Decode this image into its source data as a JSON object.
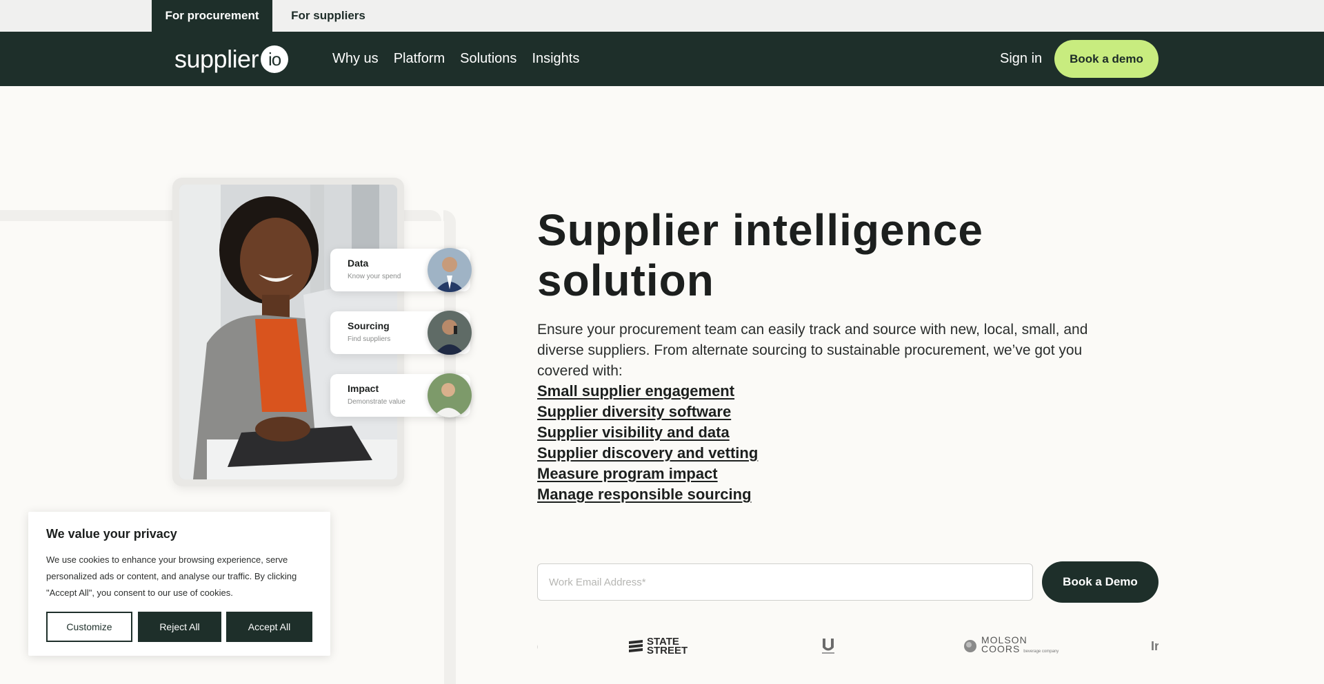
{
  "audience_tabs": [
    {
      "label": "For procurement",
      "active": true
    },
    {
      "label": "For suppliers",
      "active": false
    }
  ],
  "header": {
    "logo_text": "supplier",
    "logo_badge": "io",
    "nav": [
      "Why us",
      "Platform",
      "Solutions",
      "Insights"
    ],
    "sign_in": "Sign in",
    "cta": "Book a demo"
  },
  "feature_pills": [
    {
      "title": "Data",
      "subtitle": "Know your spend"
    },
    {
      "title": "Sourcing",
      "subtitle": "Find suppliers"
    },
    {
      "title": "Impact",
      "subtitle": "Demonstrate value"
    }
  ],
  "hero": {
    "title": "Supplier intelligence solution",
    "description": "Ensure your procurement team can easily track and source with new, local, small, and diverse suppliers. From alternate sourcing to sustainable procurement, we’ve got you covered with:",
    "links": [
      "Small supplier engagement",
      "Supplier diversity software",
      "Supplier visibility and data",
      "Supplier discovery and vetting",
      "Measure program impact",
      "Manage responsible sourcing"
    ]
  },
  "form": {
    "email_placeholder": "Work Email Address*",
    "submit": "Book a Demo"
  },
  "customer_logos": {
    "partial_left": ")",
    "state_street_line1": "STATE",
    "state_street_line2": "STREET",
    "molson_line1": "MOLSON",
    "molson_line2": "COORS",
    "molson_sub": "beverage company",
    "partial_right": "Ir"
  },
  "cookie_banner": {
    "title": "We value your privacy",
    "text": "We use cookies to enhance your browsing experience, serve personalized ads or content, and analyse our traffic. By clicking \"Accept All\", you consent to our use of cookies.",
    "customize": "Customize",
    "reject": "Reject All",
    "accept": "Accept All"
  },
  "colors": {
    "header_bg": "#1e2f2a",
    "cta_accent": "#c8ec7f",
    "page_bg": "#fbfaf7"
  }
}
